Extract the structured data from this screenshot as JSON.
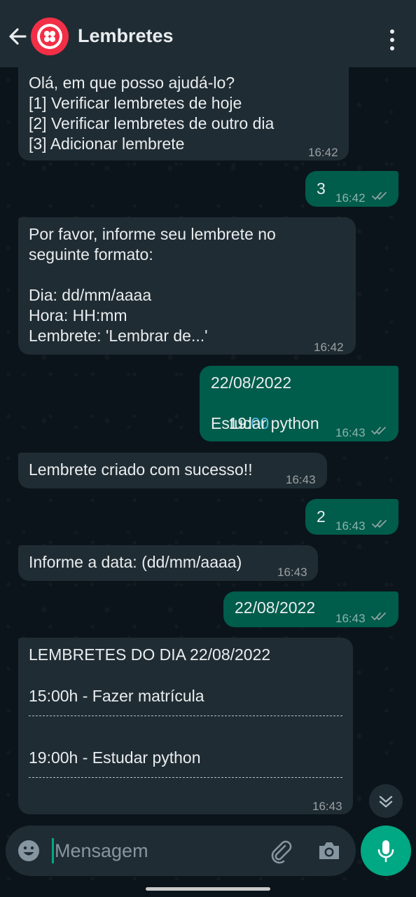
{
  "header": {
    "title": "Lembretes"
  },
  "messages": [
    {
      "id": "m1",
      "dir": "in",
      "text": "Olá, em que posso ajudá-lo?\n[1] Verificar lembretes de hoje\n[2] Verificar lembretes de outro dia\n[3] Adicionar lembrete",
      "time": "16:42"
    },
    {
      "id": "m2",
      "dir": "out",
      "text": "3",
      "time": "16:42",
      "status": "read"
    },
    {
      "id": "m3",
      "dir": "in",
      "text": "Por favor, informe seu lembrete no\nseguinte formato:\n\nDia: dd/mm/aaaa\nHora: HH:mm\nLembrete: 'Lembrar de...'",
      "time": "16:42"
    },
    {
      "id": "m4",
      "dir": "out",
      "line1": "22/08/2022",
      "line2_prefix": "19:",
      "line2_link": "00",
      "line3": "Estudar python",
      "time": "16:43",
      "status": "read"
    },
    {
      "id": "m5",
      "dir": "in",
      "text": "Lembrete criado com sucesso!!",
      "time": "16:43"
    },
    {
      "id": "m6",
      "dir": "out",
      "text": "2",
      "time": "16:43",
      "status": "read"
    },
    {
      "id": "m7",
      "dir": "in",
      "text": "Informe a data: (dd/mm/aaaa)",
      "time": "16:43"
    },
    {
      "id": "m8",
      "dir": "out",
      "text": "22/08/2022",
      "time": "16:43",
      "status": "read"
    },
    {
      "id": "m9",
      "dir": "in",
      "heading": "LEMBRETES DO DIA 22/08/2022",
      "item1": "15:00h - Fazer matrícula",
      "item2": "19:00h - Estudar python",
      "time": "16:43"
    }
  ],
  "composer": {
    "placeholder": "Mensagem"
  },
  "icons": {
    "back": "back-arrow-icon",
    "menu": "more-vert-icon",
    "scroll": "chevron-double-down-icon",
    "emoji": "emoji-icon",
    "attach": "paperclip-icon",
    "camera": "camera-icon",
    "mic": "microphone-icon",
    "read": "double-check-icon"
  },
  "colors": {
    "header": "#1f2c33",
    "incoming_bubble": "#202c33",
    "outgoing_bubble": "#005c4b",
    "accent": "#00a884",
    "link": "#53bdeb",
    "avatar": "#f22f46"
  }
}
